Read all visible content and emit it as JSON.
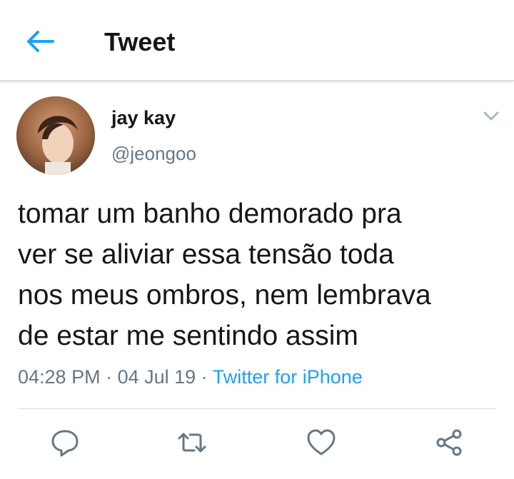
{
  "header": {
    "title": "Tweet",
    "back_icon": "arrow-left-icon"
  },
  "colors": {
    "accent": "#1da1f2",
    "text": "#14171a",
    "muted": "#657786",
    "divider": "#d8dde1"
  },
  "tweet": {
    "author_name": "jay kay",
    "author_handle": "@jeongoo",
    "text": "tomar um banho demorado pra\nver se aliviar essa tensão toda\nnos meus ombros, nem lembrava\nde estar me sentindo assim",
    "time": "04:28 PM",
    "separator1": " · ",
    "date": "04 Jul 19",
    "separator2": " · ",
    "source": "Twitter for iPhone"
  },
  "actions": [
    {
      "name": "reply",
      "icon": "reply-icon"
    },
    {
      "name": "retweet",
      "icon": "retweet-icon"
    },
    {
      "name": "like",
      "icon": "heart-icon"
    },
    {
      "name": "share",
      "icon": "share-icon"
    }
  ]
}
